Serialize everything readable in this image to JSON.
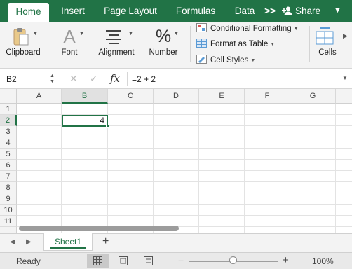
{
  "tabs": {
    "home": "Home",
    "insert": "Insert",
    "page_layout": "Page Layout",
    "formulas": "Formulas",
    "data": "Data",
    "more": ">>",
    "share": "Share"
  },
  "ribbon": {
    "clipboard": "Clipboard",
    "font": "Font",
    "alignment": "Alignment",
    "number": "Number",
    "number_glyph": "%",
    "font_glyph": "A",
    "conditional_formatting": "Conditional Formatting",
    "format_as_table": "Format as Table",
    "cell_styles": "Cell Styles",
    "cells": "Cells"
  },
  "formula_bar": {
    "name_box": "B2",
    "fx": "fx",
    "formula": "=2 + 2"
  },
  "sheet": {
    "columns": [
      "A",
      "B",
      "C",
      "D",
      "E",
      "F",
      "G"
    ],
    "rows": [
      "1",
      "2",
      "3",
      "4",
      "5",
      "6",
      "7",
      "8",
      "9",
      "10",
      "11"
    ],
    "selected_cell": "B2",
    "selected_value": "4"
  },
  "sheet_tabs": {
    "active": "Sheet1",
    "add": "+"
  },
  "status": {
    "ready": "Ready",
    "zoom_minus": "−",
    "zoom_plus": "+",
    "zoom": "100%",
    "zoom_level": 1.0
  },
  "colors": {
    "accent": "#217346",
    "ribbon_bg": "#f3f3f3"
  }
}
